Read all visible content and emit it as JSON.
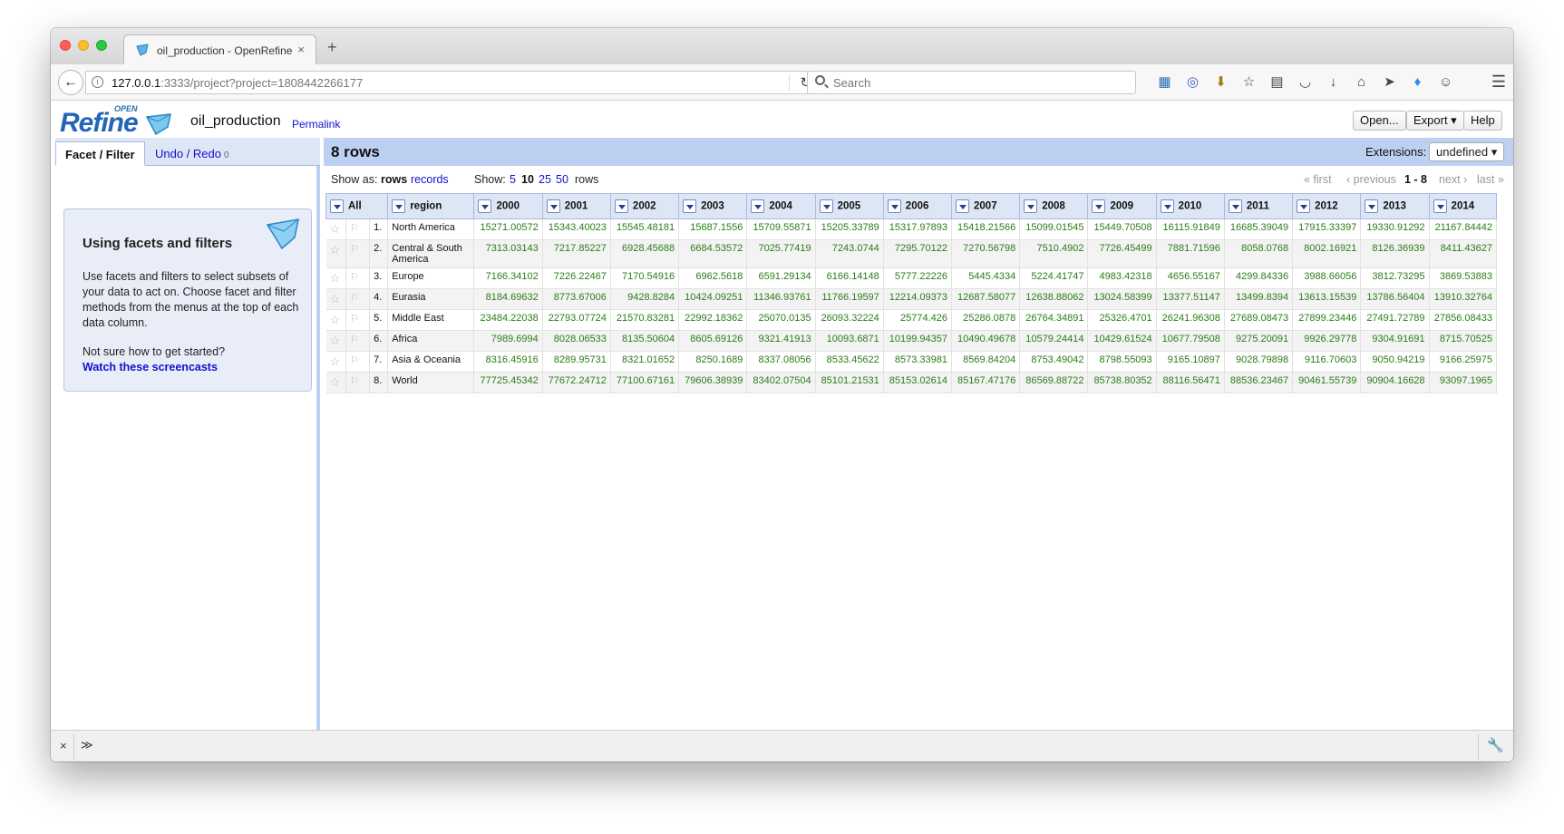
{
  "browser": {
    "tab_title": "oil_production - OpenRefine",
    "tab_close": "×",
    "new_tab": "+",
    "url_host": "127.0.0.1",
    "url_rest": ":3333/project?project=1808442266177",
    "search_placeholder": "Search"
  },
  "header": {
    "logo_open": "OPEN",
    "logo_text": "Refine",
    "project_name": "oil_production",
    "permalink": "Permalink",
    "open_button": "Open...",
    "export_button": "Export ▾",
    "help_button": "Help"
  },
  "left_panel": {
    "tab_facet": "Facet / Filter",
    "tab_undo": "Undo / Redo",
    "undo_count": "0",
    "help_title": "Using facets and filters",
    "help_body": "Use facets and filters to select subsets of your data to act on. Choose facet and filter methods from the menus at the top of each data column.",
    "help_question": "Not sure how to get started?",
    "help_link": "Watch these screencasts"
  },
  "right_panel": {
    "rows_count": "8 rows",
    "extensions_label": "Extensions:",
    "extensions_value": "undefined ▾",
    "show_as_label": "Show as:",
    "show_as_rows": "rows",
    "show_as_records": "records",
    "show_label": "Show:",
    "show_5": "5",
    "show_10": "10",
    "show_25": "25",
    "show_50": "50",
    "show_rows": "rows",
    "pager_first": "« first",
    "pager_previous": "‹ previous",
    "pager_range": "1 - 8",
    "pager_next": "next ›",
    "pager_last": "last »"
  },
  "table": {
    "all_label": "All",
    "columns": [
      "region",
      "2000",
      "2001",
      "2002",
      "2003",
      "2004",
      "2005",
      "2006",
      "2007",
      "2008",
      "2009",
      "2010",
      "2011",
      "2012",
      "2013",
      "2014"
    ],
    "rows": [
      {
        "index": "1.",
        "region": "North America",
        "values": [
          "15271.00572",
          "15343.40023",
          "15545.48181",
          "15687.1556",
          "15709.55871",
          "15205.33789",
          "15317.97893",
          "15418.21566",
          "15099.01545",
          "15449.70508",
          "16115.91849",
          "16685.39049",
          "17915.33397",
          "19330.91292",
          "21167.84442"
        ]
      },
      {
        "index": "2.",
        "region": "Central & South America",
        "values": [
          "7313.03143",
          "7217.85227",
          "6928.45688",
          "6684.53572",
          "7025.77419",
          "7243.0744",
          "7295.70122",
          "7270.56798",
          "7510.4902",
          "7726.45499",
          "7881.71596",
          "8058.0768",
          "8002.16921",
          "8126.36939",
          "8411.43627"
        ]
      },
      {
        "index": "3.",
        "region": "Europe",
        "values": [
          "7166.34102",
          "7226.22467",
          "7170.54916",
          "6962.5618",
          "6591.29134",
          "6166.14148",
          "5777.22226",
          "5445.4334",
          "5224.41747",
          "4983.42318",
          "4656.55167",
          "4299.84336",
          "3988.66056",
          "3812.73295",
          "3869.53883"
        ]
      },
      {
        "index": "4.",
        "region": "Eurasia",
        "values": [
          "8184.69632",
          "8773.67006",
          "9428.8284",
          "10424.09251",
          "11346.93761",
          "11766.19597",
          "12214.09373",
          "12687.58077",
          "12638.88062",
          "13024.58399",
          "13377.51147",
          "13499.8394",
          "13613.15539",
          "13786.56404",
          "13910.32764"
        ]
      },
      {
        "index": "5.",
        "region": "Middle East",
        "values": [
          "23484.22038",
          "22793.07724",
          "21570.83281",
          "22992.18362",
          "25070.0135",
          "26093.32224",
          "25774.426",
          "25286.0878",
          "26764.34891",
          "25326.4701",
          "26241.96308",
          "27689.08473",
          "27899.23446",
          "27491.72789",
          "27856.08433"
        ]
      },
      {
        "index": "6.",
        "region": "Africa",
        "values": [
          "7989.6994",
          "8028.06533",
          "8135.50604",
          "8605.69126",
          "9321.41913",
          "10093.6871",
          "10199.94357",
          "10490.49678",
          "10579.24414",
          "10429.61524",
          "10677.79508",
          "9275.20091",
          "9926.29778",
          "9304.91691",
          "8715.70525"
        ]
      },
      {
        "index": "7.",
        "region": "Asia & Oceania",
        "values": [
          "8316.45916",
          "8289.95731",
          "8321.01652",
          "8250.1689",
          "8337.08056",
          "8533.45622",
          "8573.33981",
          "8569.84204",
          "8753.49042",
          "8798.55093",
          "9165.10897",
          "9028.79898",
          "9116.70603",
          "9050.94219",
          "9166.25975"
        ]
      },
      {
        "index": "8.",
        "region": "World",
        "values": [
          "77725.45342",
          "77672.24712",
          "77100.67161",
          "79606.38939",
          "83402.07504",
          "85101.21531",
          "85153.02614",
          "85167.47176",
          "86569.88722",
          "85738.80352",
          "88116.56471",
          "88536.23467",
          "90461.55739",
          "90904.16628",
          "93097.1965"
        ]
      }
    ]
  },
  "bottom_bar": {
    "close": "×",
    "expand": "≫"
  }
}
